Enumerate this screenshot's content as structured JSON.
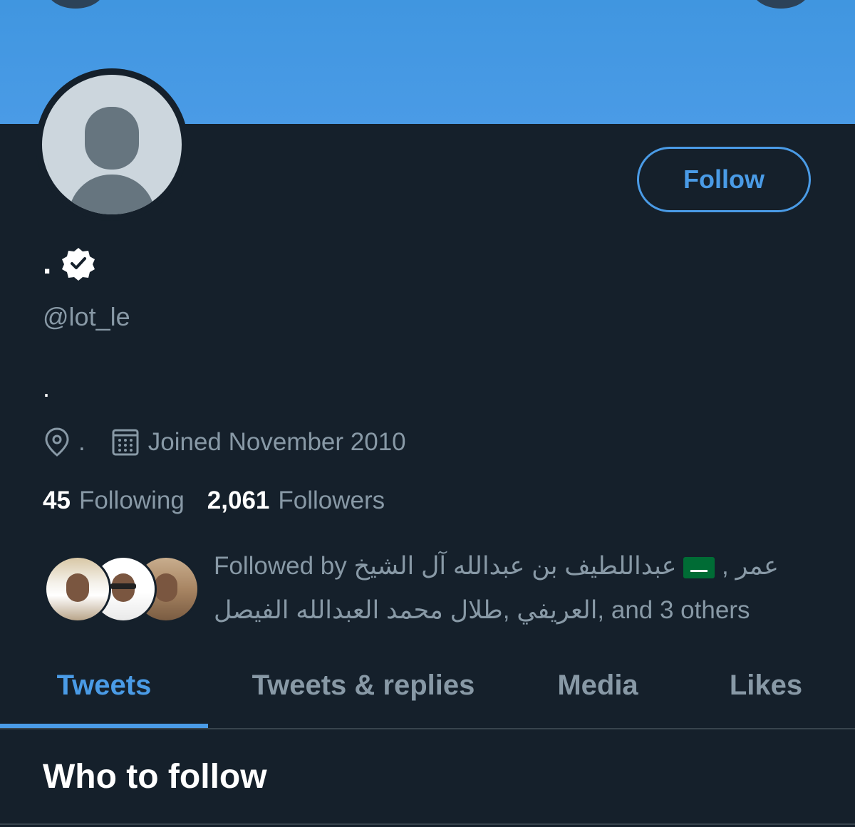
{
  "colors": {
    "accent": "#4a9be6",
    "background": "#15202b",
    "secondary_text": "#8899a6",
    "divider": "#38444d"
  },
  "header": {
    "follow_label": "Follow"
  },
  "profile": {
    "display_name": ".",
    "verified": true,
    "handle": "@lot_le",
    "bio": ".",
    "location": ".",
    "joined": "Joined November 2010",
    "following_count": "45",
    "following_label": "Following",
    "followers_count": "2,061",
    "followers_label": "Followers"
  },
  "followed_by": {
    "prefix": "Followed by",
    "name_1": "عبداللطيف بن عبدالله آل الشيخ",
    "name_2": "عمر",
    "name_3": "العريفي",
    "name_4": "طلال محمد العبدالله الفيصل",
    "separator_1": ",",
    "separator_2": ",",
    "suffix": ", and 3 others"
  },
  "tabs": [
    {
      "label": "Tweets",
      "active": true
    },
    {
      "label": "Tweets & replies",
      "active": false
    },
    {
      "label": "Media",
      "active": false
    },
    {
      "label": "Likes",
      "active": false
    }
  ],
  "section": {
    "title": "Who to follow"
  },
  "icons": {
    "verified": "verified-badge-icon",
    "location": "location-pin-icon",
    "calendar": "calendar-icon",
    "flag": "saudi-flag-emoji"
  }
}
